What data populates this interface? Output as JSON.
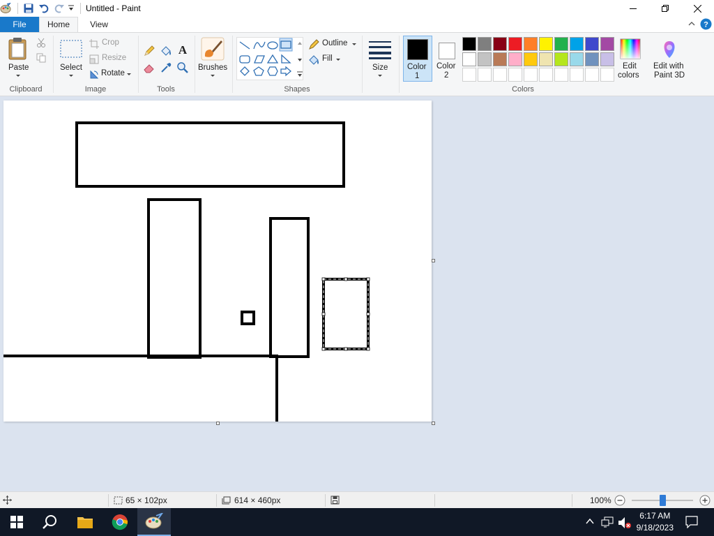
{
  "window": {
    "title": "Untitled - Paint"
  },
  "tabs": {
    "file": "File",
    "home": "Home",
    "view": "View"
  },
  "clipboard": {
    "paste": "Paste",
    "label": "Clipboard"
  },
  "image": {
    "select": "Select",
    "crop": "Crop",
    "resize": "Resize",
    "rotate": "Rotate",
    "label": "Image"
  },
  "tools": {
    "label": "Tools"
  },
  "brushes": {
    "label": "Brushes"
  },
  "shapes": {
    "outline": "Outline",
    "fill": "Fill",
    "label": "Shapes"
  },
  "size": {
    "label": "Size"
  },
  "colors": {
    "color1_line1": "Color",
    "color1_line2": "1",
    "color2_line1": "Color",
    "color2_line2": "2",
    "edit_line1": "Edit",
    "edit_line2": "colors",
    "paint3d_line1": "Edit with",
    "paint3d_line2": "Paint 3D",
    "label": "Colors",
    "color1_value": "#000000",
    "color2_value": "#ffffff",
    "palette_row1": [
      "#000000",
      "#7f7f7f",
      "#880015",
      "#ed1c24",
      "#ff7f27",
      "#fff200",
      "#22b14c",
      "#00a2e8",
      "#3f48cc",
      "#a349a4"
    ],
    "palette_row2": [
      "#ffffff",
      "#c3c3c3",
      "#b97a57",
      "#ffaec9",
      "#ffc90e",
      "#efe4b0",
      "#b5e61d",
      "#99d9ea",
      "#7092be",
      "#c8bfe7"
    ]
  },
  "status": {
    "selection_size": "65 × 102px",
    "image_size": "614 × 460px",
    "zoom": "100%",
    "zoom_level": 0.5
  },
  "clock": {
    "time": "6:17 AM",
    "date": "9/18/2023"
  }
}
